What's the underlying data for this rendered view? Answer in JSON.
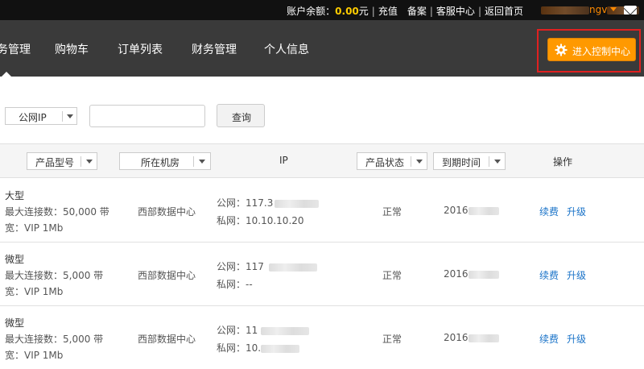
{
  "topbar": {
    "balance_label": "账户余额：",
    "balance_amount": "0.00",
    "balance_unit": "元",
    "recharge": "充值",
    "filing": "备案",
    "support": "客服中心",
    "home": "返回首页",
    "username_visible": "ngv"
  },
  "nav": {
    "items": [
      "务管理",
      "购物车",
      "订单列表",
      "财务管理",
      "个人信息"
    ],
    "control_center": "进入控制中心"
  },
  "filter": {
    "ip_type_selected": "公网IP",
    "search_value": "",
    "query_button": "查询"
  },
  "table": {
    "headers": {
      "product_model": "产品型号",
      "datacenter": "所在机房",
      "ip": "IP",
      "status": "产品状态",
      "expire": "到期时间",
      "actions": "操作"
    },
    "rows": [
      {
        "name": "大型",
        "spec1": "最大连接数：50,000 带",
        "spec2": "宽：VIP 1Mb",
        "datacenter": "西部数据中心",
        "public_ip": "公网：117.3",
        "private_ip": "私网：10.10.10.20",
        "status": "正常",
        "expire": "2016",
        "renew": "续费",
        "upgrade": "升级"
      },
      {
        "name": "微型",
        "spec1": "最大连接数：5,000 带",
        "spec2": "宽：VIP 1Mb",
        "datacenter": "西部数据中心",
        "public_ip": "公网：117",
        "private_ip": "私网：--",
        "status": "正常",
        "expire": "2016",
        "renew": "续费",
        "upgrade": "升级"
      },
      {
        "name": "微型",
        "spec1": "最大连接数：5,000 带",
        "spec2": "宽：VIP 1Mb",
        "datacenter": "西部数据中心",
        "public_ip": "公网：11",
        "private_ip": "私网：10.",
        "status": "正常",
        "expire": "2016",
        "renew": "续费",
        "upgrade": "升级"
      }
    ]
  },
  "colors": {
    "accent_orange": "#ff9900",
    "highlight_red": "#e02020",
    "link_blue": "#1a73c8",
    "balance_yellow": "#ffcc00"
  },
  "icons": [
    "gear-icon",
    "mail-icon",
    "chevron-down-icon"
  ]
}
